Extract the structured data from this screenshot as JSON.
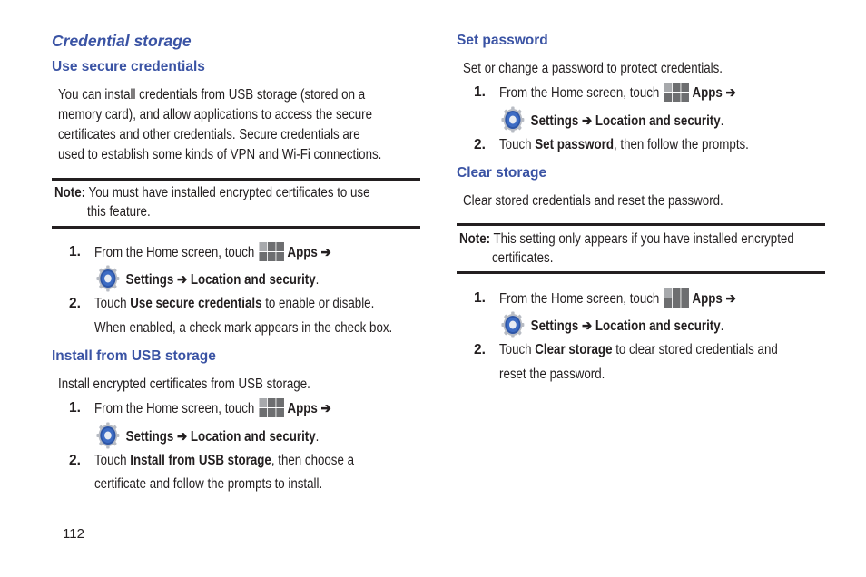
{
  "left_column": {
    "title": "Credential storage",
    "use_secure": {
      "heading": "Use secure credentials",
      "para_lines": [
        "You can install credentials from USB storage (stored on a",
        "memory card), and allow applications to access the secure",
        "certificates and other credentials. Secure credentials are",
        "used to establish some kinds of VPN and Wi-Fi connections."
      ],
      "note": {
        "label": "Note:",
        "line1": "You must have installed encrypted certificates to use",
        "line2": "this feature."
      },
      "steps": [
        {
          "num": "1.",
          "pre": "From the Home screen, touch",
          "apps": "Apps",
          "arrow": "➔",
          "settings": "Settings",
          "arrow2": "➔",
          "location": "Location and security",
          "end": "."
        },
        {
          "num": "2.",
          "pre": "Touch",
          "bold": "Use secure credentials",
          "post": "to enable or disable.",
          "line2": "When enabled, a check mark appears in the check box."
        }
      ]
    },
    "install_usb": {
      "heading": "Install from USB storage",
      "para": "Install encrypted certificates from USB storage.",
      "steps": [
        {
          "num": "1.",
          "pre": "From the Home screen, touch",
          "apps": "Apps",
          "arrow": "➔",
          "settings": "Settings",
          "arrow2": "➔",
          "location": "Location and security",
          "end": "."
        },
        {
          "num": "2.",
          "pre": "Touch",
          "bold": "Install from USB storage",
          "post": ", then choose a",
          "line2": "certificate and follow the prompts to install."
        }
      ]
    },
    "page_number": "112"
  },
  "right_column": {
    "set_password": {
      "heading": "Set password",
      "para": "Set or change a password to protect credentials.",
      "steps": [
        {
          "num": "1.",
          "pre": "From the Home screen, touch",
          "apps": "Apps",
          "arrow": "➔",
          "settings": "Settings",
          "arrow2": "➔",
          "location": "Location and security",
          "end": "."
        },
        {
          "num": "2.",
          "pre": "Touch",
          "bold": "Set password",
          "post": ", then follow the prompts."
        }
      ]
    },
    "clear_storage": {
      "heading": "Clear storage",
      "para": "Clear stored credentials and reset the password.",
      "note": {
        "label": "Note:",
        "line1": "This setting only appears if you have installed encrypted",
        "line2": "certificates."
      },
      "steps": [
        {
          "num": "1.",
          "pre": "From the Home screen, touch",
          "apps": "Apps",
          "arrow": "➔",
          "settings": "Settings",
          "arrow2": "➔",
          "location": "Location and security",
          "end": "."
        },
        {
          "num": "2.",
          "pre": "Touch",
          "bold": "Clear storage",
          "post": "to clear stored credentials and",
          "line2": "reset the password."
        }
      ]
    }
  },
  "icons": {
    "apps": "apps-grid-icon",
    "settings": "settings-gear-icon"
  },
  "colors": {
    "heading": "#3a53a4",
    "text": "#231f20",
    "apps_dark": "#6d6e70",
    "apps_light": "#a7a9ac",
    "gear_blue": "#2e56a6"
  }
}
